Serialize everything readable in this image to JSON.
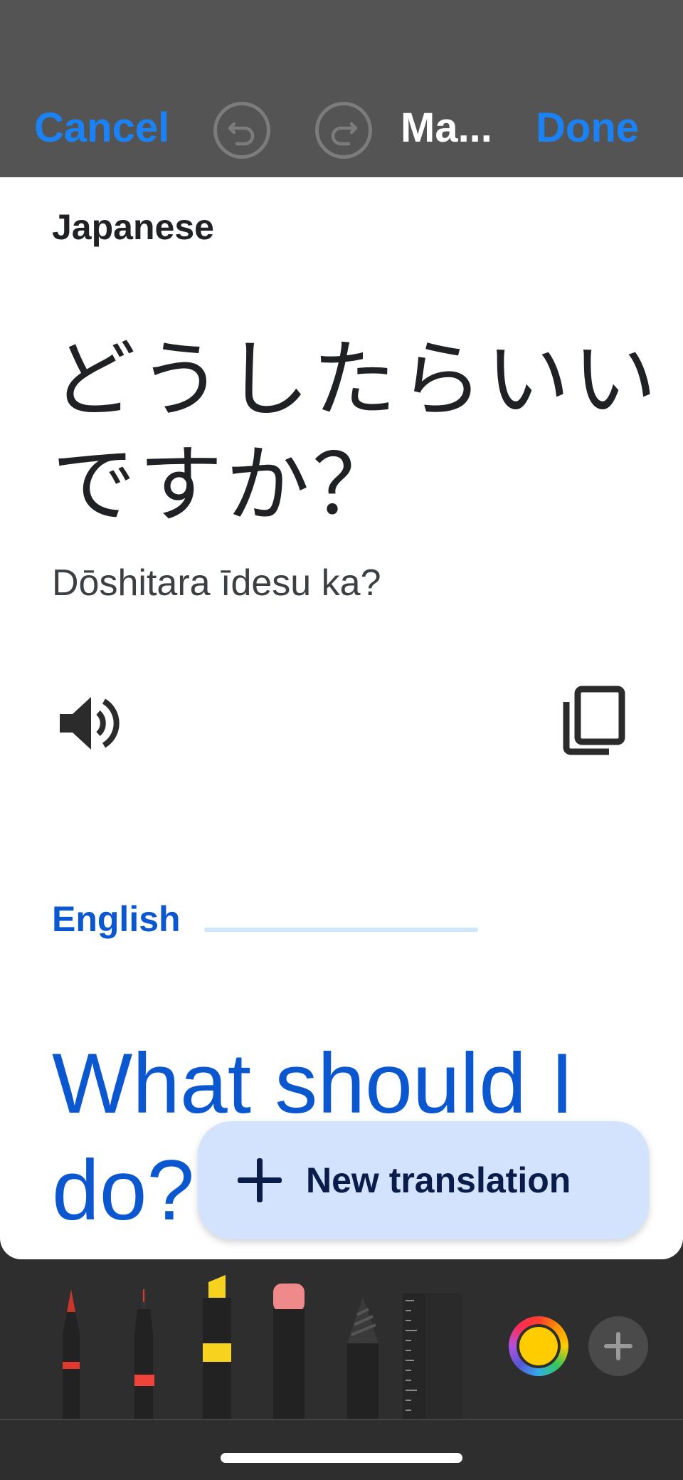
{
  "topbar": {
    "cancel_label": "Cancel",
    "title": "Ma...",
    "done_label": "Done"
  },
  "source": {
    "language": "Japanese",
    "text_line1": "どうしたらいい",
    "text_line2": "ですか？",
    "romanization": "Dōshitara īdesu ka?"
  },
  "target": {
    "language": "English",
    "text_line1": "What should I",
    "text_line2": "do?"
  },
  "fab": {
    "label": "New translation"
  },
  "palette": {
    "tools": [
      "pen",
      "fine-liner",
      "highlighter",
      "eraser",
      "pencil",
      "ruler"
    ],
    "selected_color": "#ffcc00"
  },
  "colors": {
    "accent": "#1a82f5",
    "translation_blue": "#0b57d0",
    "fab_bg": "#d3e3fd"
  }
}
